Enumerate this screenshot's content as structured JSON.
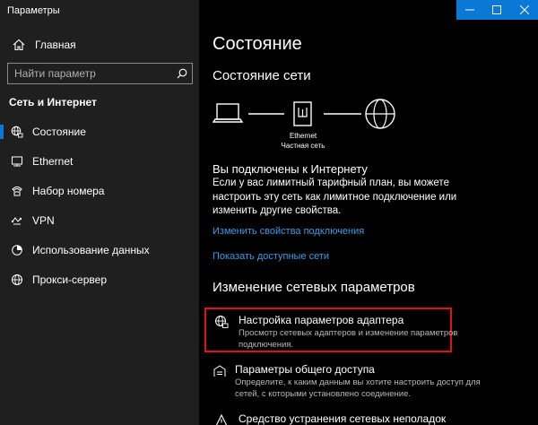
{
  "window": {
    "title": "Параметры",
    "controls": [
      "minimize",
      "maximize",
      "close"
    ]
  },
  "sidebar": {
    "home_label": "Главная",
    "search_placeholder": "Найти параметр",
    "section_title": "Сеть и Интернет",
    "items": [
      {
        "label": "Состояние",
        "icon": "globe-network-icon",
        "active": true
      },
      {
        "label": "Ethernet",
        "icon": "ethernet-icon",
        "active": false
      },
      {
        "label": "Набор номера",
        "icon": "dialup-icon",
        "active": false
      },
      {
        "label": "VPN",
        "icon": "vpn-icon",
        "active": false
      },
      {
        "label": "Использование данных",
        "icon": "data-usage-icon",
        "active": false
      },
      {
        "label": "Прокси-сервер",
        "icon": "globe-icon",
        "active": false
      }
    ]
  },
  "main": {
    "title": "Состояние",
    "network_status_heading": "Состояние сети",
    "diagram": {
      "adapter_name": "Ethernet",
      "network_name": "Частная сеть"
    },
    "connected_title": "Вы подключены к Интернету",
    "connected_desc": "Если у вас лимитный тарифный план, вы можете настроить эту сеть как лимитное подключение или изменить другие свойства.",
    "link_properties": "Изменить свойства подключения",
    "link_available": "Показать доступные сети",
    "change_heading": "Изменение сетевых параметров",
    "settings": [
      {
        "title": "Настройка параметров адаптера",
        "desc": "Просмотр сетевых адаптеров и изменение параметров подключения.",
        "icon": "adapter-icon",
        "highlighted": true
      },
      {
        "title": "Параметры общего доступа",
        "desc": "Определите, к каким данным вы хотите настроить доступ для сетей, с которыми установлено соединение.",
        "icon": "sharing-icon",
        "highlighted": false
      },
      {
        "title": "Средство устранения сетевых неполадок",
        "desc": "",
        "icon": "troubleshoot-icon",
        "highlighted": false
      }
    ]
  },
  "colors": {
    "accent": "#0a78d7",
    "link": "#3a9ce8",
    "highlight_border": "#e0101e",
    "sidebar_bg": "#1f1f1f",
    "main_bg": "#000000"
  }
}
